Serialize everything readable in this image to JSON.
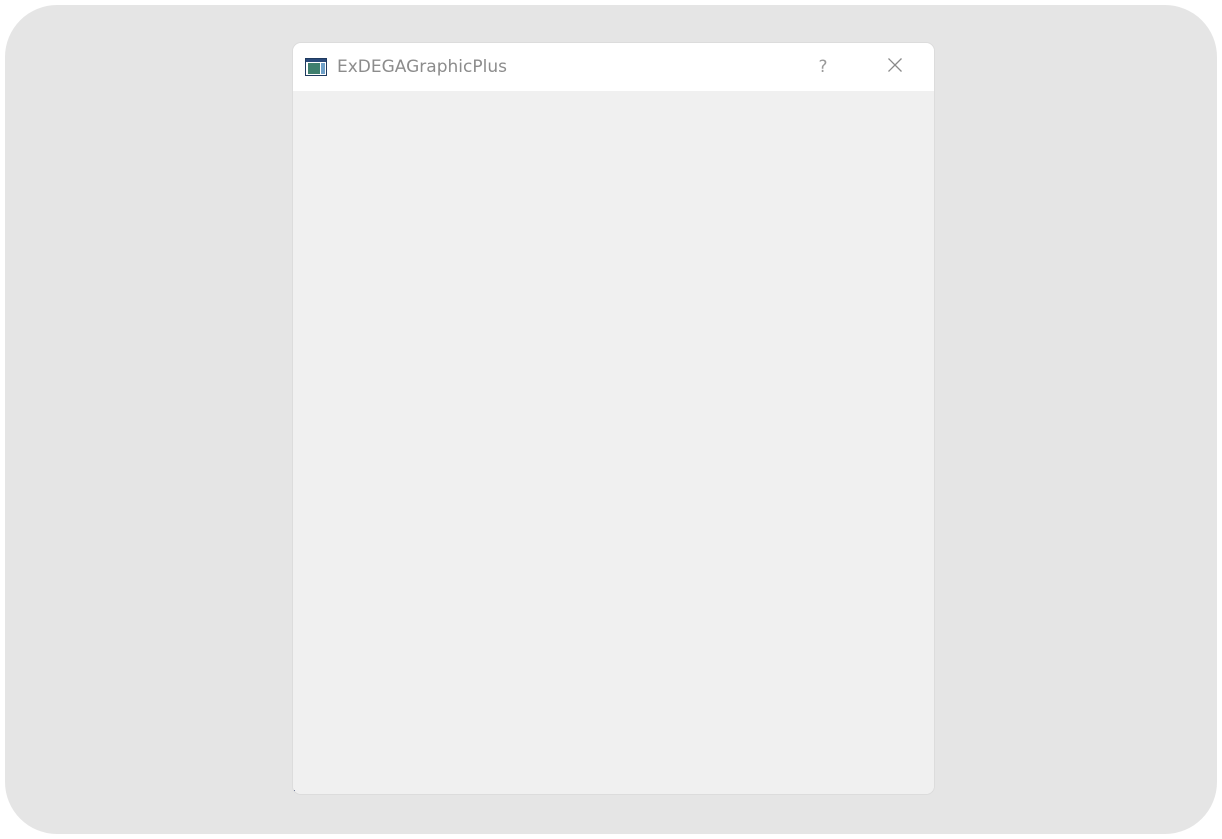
{
  "window": {
    "title": "ExDEGAGraphicPlus",
    "help_label": "?",
    "icons": {
      "app": "app-window-icon",
      "close": "close-icon"
    }
  },
  "colors": {
    "desktop": "#e5e5e5",
    "titlebar": "#ffffff",
    "client": "#f0f0f0",
    "title_text": "#8c8c8c"
  }
}
